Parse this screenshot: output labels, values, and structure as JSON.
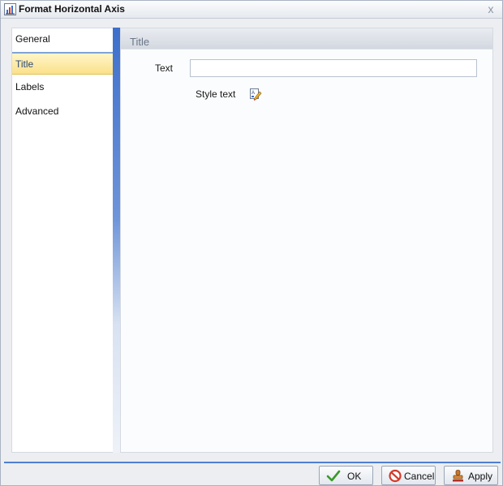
{
  "window": {
    "title": "Format Horizontal Axis",
    "close_glyph": "x"
  },
  "nav": {
    "items": [
      {
        "label": "General",
        "selected": false
      },
      {
        "label": "Title",
        "selected": true
      },
      {
        "label": "Labels",
        "selected": false
      },
      {
        "label": "Advanced",
        "selected": false
      }
    ]
  },
  "panel": {
    "section_title": "Title",
    "text_label": "Text",
    "text_value": "",
    "style_text_label": "Style text"
  },
  "buttons": {
    "ok": "OK",
    "cancel": "Cancel",
    "apply": "Apply"
  },
  "icons": {
    "app": "chart-axis-icon",
    "style": "style-brush-icon",
    "ok": "checkmark-icon",
    "cancel": "no-entry-icon",
    "apply": "stamp-icon"
  },
  "colors": {
    "accent": "#4f80d0",
    "selected_bg": "#fbe08a",
    "ok_check": "#3a9a2a",
    "cancel_red": "#d23a2a"
  }
}
